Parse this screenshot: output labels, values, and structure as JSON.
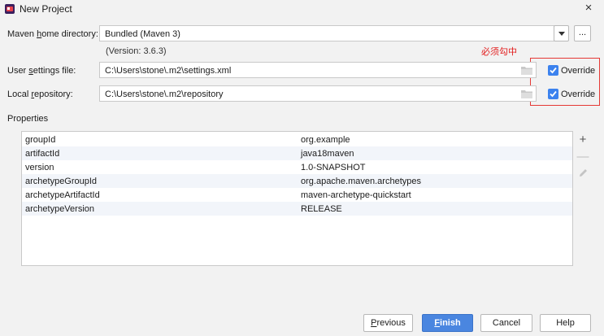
{
  "window": {
    "title": "New Project",
    "icon": "intellij-app-icon",
    "close_glyph": "×"
  },
  "maven_home": {
    "label_pre": "Maven ",
    "label_mnemonic": "h",
    "label_post": "ome directory:",
    "value": "Bundled (Maven 3)",
    "version": "(Version: 3.6.3)",
    "more_label": "..."
  },
  "annotation": {
    "text": "必须勾中",
    "color": "#e21b1b"
  },
  "user_settings": {
    "label_pre": "User ",
    "label_mnemonic": "s",
    "label_post": "ettings file:",
    "value": "C:\\Users\\stone\\.m2\\settings.xml",
    "override_label": "Override",
    "override_checked": true
  },
  "local_repo": {
    "label_pre": "Local ",
    "label_mnemonic": "r",
    "label_post": "epository:",
    "value": "C:\\Users\\stone\\.m2\\repository",
    "override_label": "Override",
    "override_checked": true
  },
  "properties": {
    "heading": "Properties",
    "rows": [
      {
        "key": "groupId",
        "value": "org.example"
      },
      {
        "key": "artifactId",
        "value": "java18maven"
      },
      {
        "key": "version",
        "value": "1.0-SNAPSHOT"
      },
      {
        "key": "archetypeGroupId",
        "value": "org.apache.maven.archetypes"
      },
      {
        "key": "archetypeArtifactId",
        "value": "maven-archetype-quickstart"
      },
      {
        "key": "archetypeVersion",
        "value": "RELEASE"
      }
    ],
    "add_glyph": "+",
    "remove_glyph": "—"
  },
  "buttons": {
    "previous_mnemonic": "P",
    "previous_rest": "revious",
    "finish_mnemonic": "F",
    "finish_rest": "inish",
    "cancel": "Cancel",
    "help": "Help"
  },
  "colors": {
    "accent": "#4a86e0",
    "checkbox": "#3c82ee",
    "highlight_box": "#e53935",
    "dialog_bg": "#f2f2f2"
  }
}
